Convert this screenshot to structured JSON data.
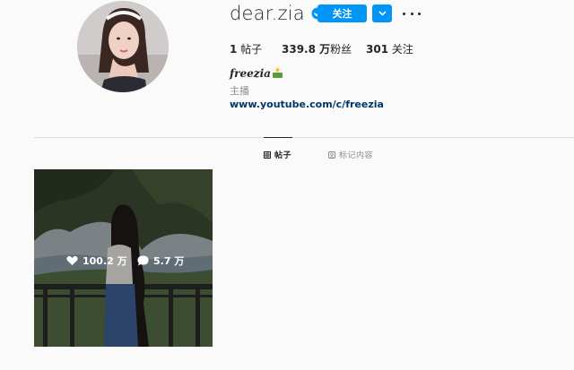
{
  "profile": {
    "username": "dear.zia",
    "verified": true,
    "follow_label": "关注",
    "fullname": "𝒇𝒓𝒆𝒆𝒛𝒊𝒂 .",
    "category": "主播",
    "link": "www.youtube.com/c/freezia"
  },
  "stats": {
    "posts_count": "1",
    "posts_label": " 帖子",
    "followers_count": "339.8 万",
    "followers_label": "粉丝",
    "following_count": "301",
    "following_label": " 关注"
  },
  "tabs": {
    "posts": "帖子",
    "tagged": "标记内容"
  },
  "post": {
    "likes": "100.2 万",
    "comments": "5.7 万"
  },
  "colors": {
    "accent": "#0095f6",
    "link": "#00376b",
    "muted": "#8e8e8e"
  }
}
